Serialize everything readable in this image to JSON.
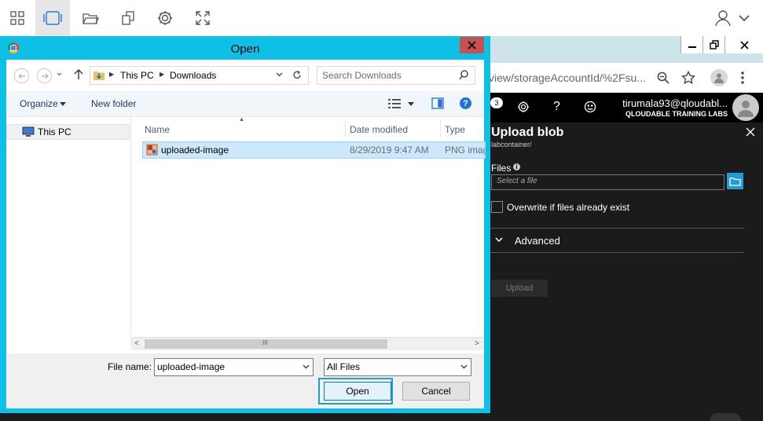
{
  "browser": {
    "address_url": "view/storageAccountId/%2Fsu...",
    "user_name": "tirumala93@qloudabl...",
    "org_name": "QLOUDABLE TRAINING LABS",
    "notification_count": "3"
  },
  "upload_panel": {
    "title": "Upload blob",
    "container_path": "labcontainer/",
    "files_label": "Files",
    "file_placeholder": "Select a file",
    "overwrite_label": "Overwrite if files already exist",
    "advanced_label": "Advanced",
    "upload_label": "Upload"
  },
  "dialog": {
    "title": "Open",
    "breadcrumb": [
      "This PC",
      "Downloads"
    ],
    "search_placeholder": "Search Downloads",
    "organize_label": "Organize",
    "new_folder_label": "New folder",
    "nav_tree": [
      {
        "label": "This PC"
      }
    ],
    "columns": {
      "name": "Name",
      "date": "Date modified",
      "type": "Type"
    },
    "files": [
      {
        "name": "uploaded-image",
        "date": "8/29/2019 9:47 AM",
        "type": "PNG imag"
      }
    ],
    "scroll_thumb": "III",
    "filename_label": "File name:",
    "filename_value": "uploaded-image",
    "filetype_value": "All Files",
    "open_label": "Open",
    "cancel_label": "Cancel"
  },
  "colors": {
    "dialog_frame": "#0fc0e6",
    "close_red": "#c75050",
    "selection": "#cce8ff",
    "accent_blue": "#1f9bd7"
  }
}
